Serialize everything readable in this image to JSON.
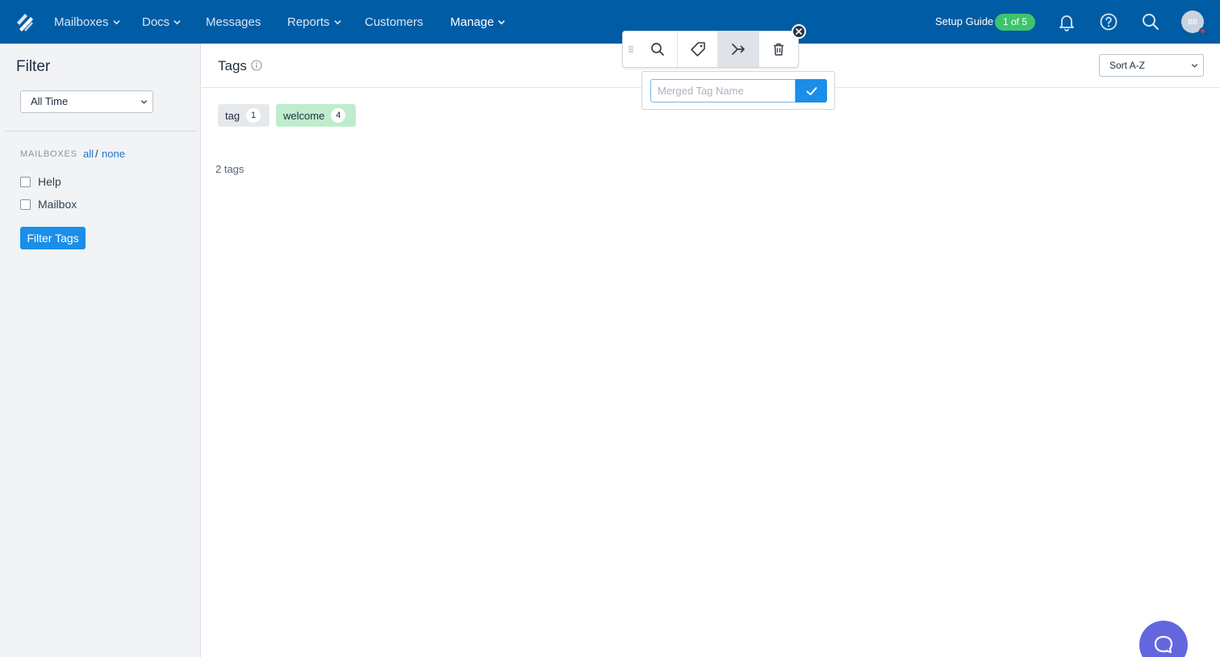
{
  "nav": {
    "items": [
      {
        "label": "Mailboxes",
        "dropdown": true
      },
      {
        "label": "Docs",
        "dropdown": true
      },
      {
        "label": "Messages",
        "dropdown": false
      },
      {
        "label": "Reports",
        "dropdown": true
      },
      {
        "label": "Customers",
        "dropdown": false
      },
      {
        "label": "Manage",
        "dropdown": true,
        "active": true
      }
    ],
    "setup_guide_label": "Setup Guide",
    "setup_guide_progress": "1 of 5",
    "avatar_initials": "BB",
    "icons": [
      "bell-icon",
      "help-icon",
      "search-icon"
    ]
  },
  "sidebar": {
    "title": "Filter",
    "time_range": "All Time",
    "mailboxes_label": "MAILBOXES",
    "all_link": "all",
    "separator": "/",
    "none_link": "none",
    "mailboxes": [
      {
        "label": "Help",
        "checked": false
      },
      {
        "label": "Mailbox",
        "checked": false
      }
    ],
    "filter_button": "Filter Tags"
  },
  "main": {
    "title": "Tags",
    "sort": "Sort A-Z",
    "tags": [
      {
        "name": "tag",
        "count": "1",
        "color": "#e6e9ec"
      },
      {
        "name": "welcome",
        "count": "4",
        "color": "#bfeccd"
      }
    ],
    "tag_count_text": "2 tags"
  },
  "toolbar": {
    "buttons": [
      "search-icon",
      "tag-icon",
      "merge-icon",
      "trash-icon"
    ],
    "active_button": "merge-icon"
  },
  "merge_popover": {
    "placeholder": "Merged Tag Name",
    "value": ""
  },
  "colors": {
    "nav_bg": "#005ca4",
    "accent": "#1a8ee8",
    "setup_badge": "#3ec46d",
    "beacon": "#6466de"
  }
}
